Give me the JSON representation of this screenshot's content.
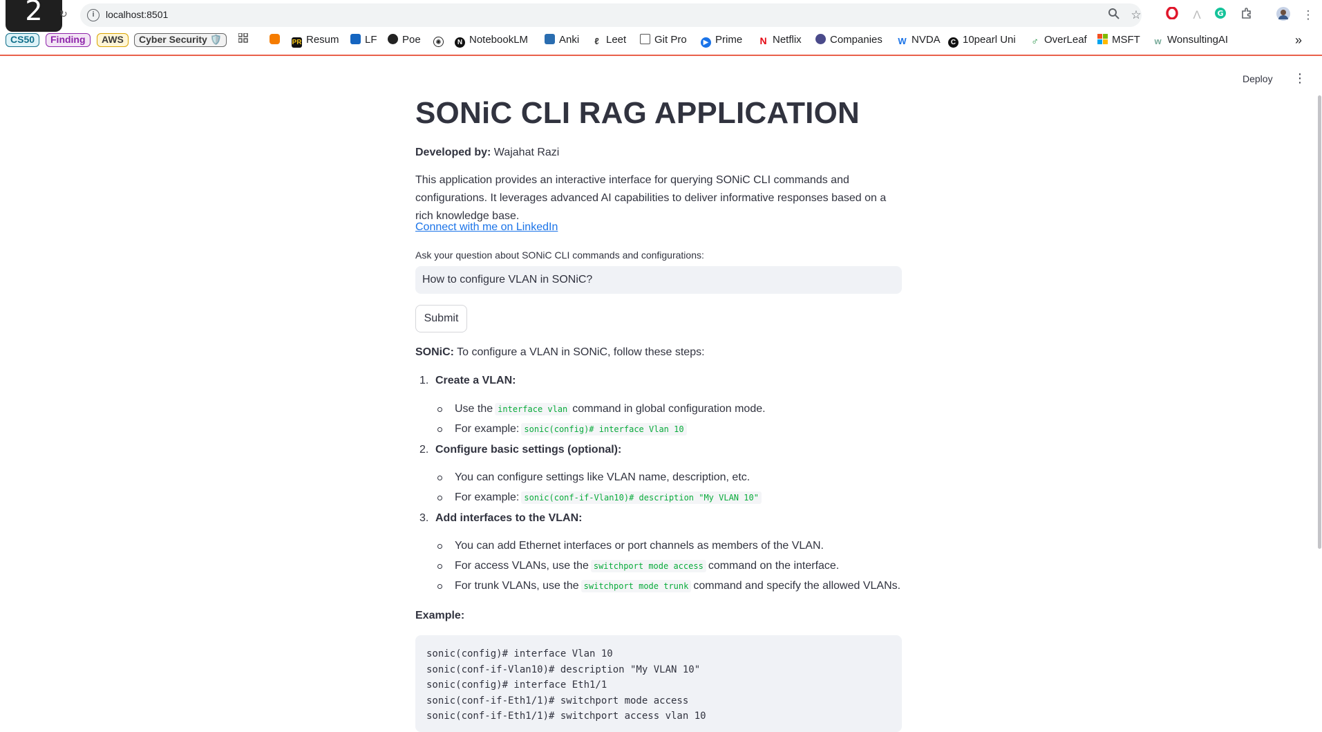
{
  "browser": {
    "badge": "2",
    "url": "localhost:8501",
    "bookmarks": {
      "pills": [
        "CS50",
        "Finding",
        "AWS",
        "Cyber Security 🛡️"
      ],
      "items": [
        "Resum",
        "LF",
        "Poe",
        "NotebookLM",
        "Anki",
        "Leet",
        "Git Pro",
        "Prime",
        "Netflix",
        "Companies",
        "NVDA",
        "10pearl Uni",
        "OverLeaf",
        "MSFT",
        "WonsultingAI"
      ],
      "more_glyph": "»"
    }
  },
  "header": {
    "deploy_label": "Deploy"
  },
  "page": {
    "title": "SONiC CLI RAG APPLICATION",
    "developed_by_label": "Developed by:",
    "developed_by_name": " Wajahat Razi",
    "description": "This application provides an interactive interface for querying SONiC CLI commands and configurations. It leverages advanced AI capabilities to deliver informative responses based on a rich knowledge base.",
    "linkedin_text": "Connect with me on LinkedIn",
    "question_label": "Ask your question about SONiC CLI commands and configurations:",
    "question_value": "How to configure VLAN in SONiC?",
    "submit_label": "Submit"
  },
  "answer": {
    "intro_label": "SONiC:",
    "intro_text": " To configure a VLAN in SONiC, follow these steps:",
    "steps": [
      {
        "number": "1.",
        "title": "Create a VLAN:",
        "bullets": [
          {
            "before": "Use the",
            "code": "interface vlan",
            "after": "command in global configuration mode."
          },
          {
            "before": "For example:",
            "code": "sonic(config)# interface Vlan 10",
            "after": ""
          }
        ]
      },
      {
        "number": "2.",
        "title": "Configure basic settings (optional):",
        "bullets": [
          {
            "before": "You can configure settings like VLAN name, description, etc.",
            "code": "",
            "after": ""
          },
          {
            "before": "For example:",
            "code": "sonic(conf-if-Vlan10)# description \"My VLAN 10\"",
            "after": ""
          }
        ]
      },
      {
        "number": "3.",
        "title": "Add interfaces to the VLAN:",
        "bullets": [
          {
            "before": "You can add Ethernet interfaces or port channels as members of the VLAN.",
            "code": "",
            "after": ""
          },
          {
            "before": "For access VLANs, use the",
            "code": "switchport mode access",
            "after": "command on the interface."
          },
          {
            "before": "For trunk VLANs, use the",
            "code": "switchport mode trunk",
            "after": "command and specify the allowed VLANs."
          }
        ]
      }
    ],
    "example_label": "Example:",
    "code_lines": [
      "sonic(config)# interface Vlan 10",
      "sonic(conf-if-Vlan10)# description \"My VLAN 10\"",
      "sonic(config)# interface Eth1/1",
      "sonic(conf-if-Eth1/1)# switchport mode access",
      "sonic(conf-if-Eth1/1)# switchport access vlan 10"
    ]
  }
}
